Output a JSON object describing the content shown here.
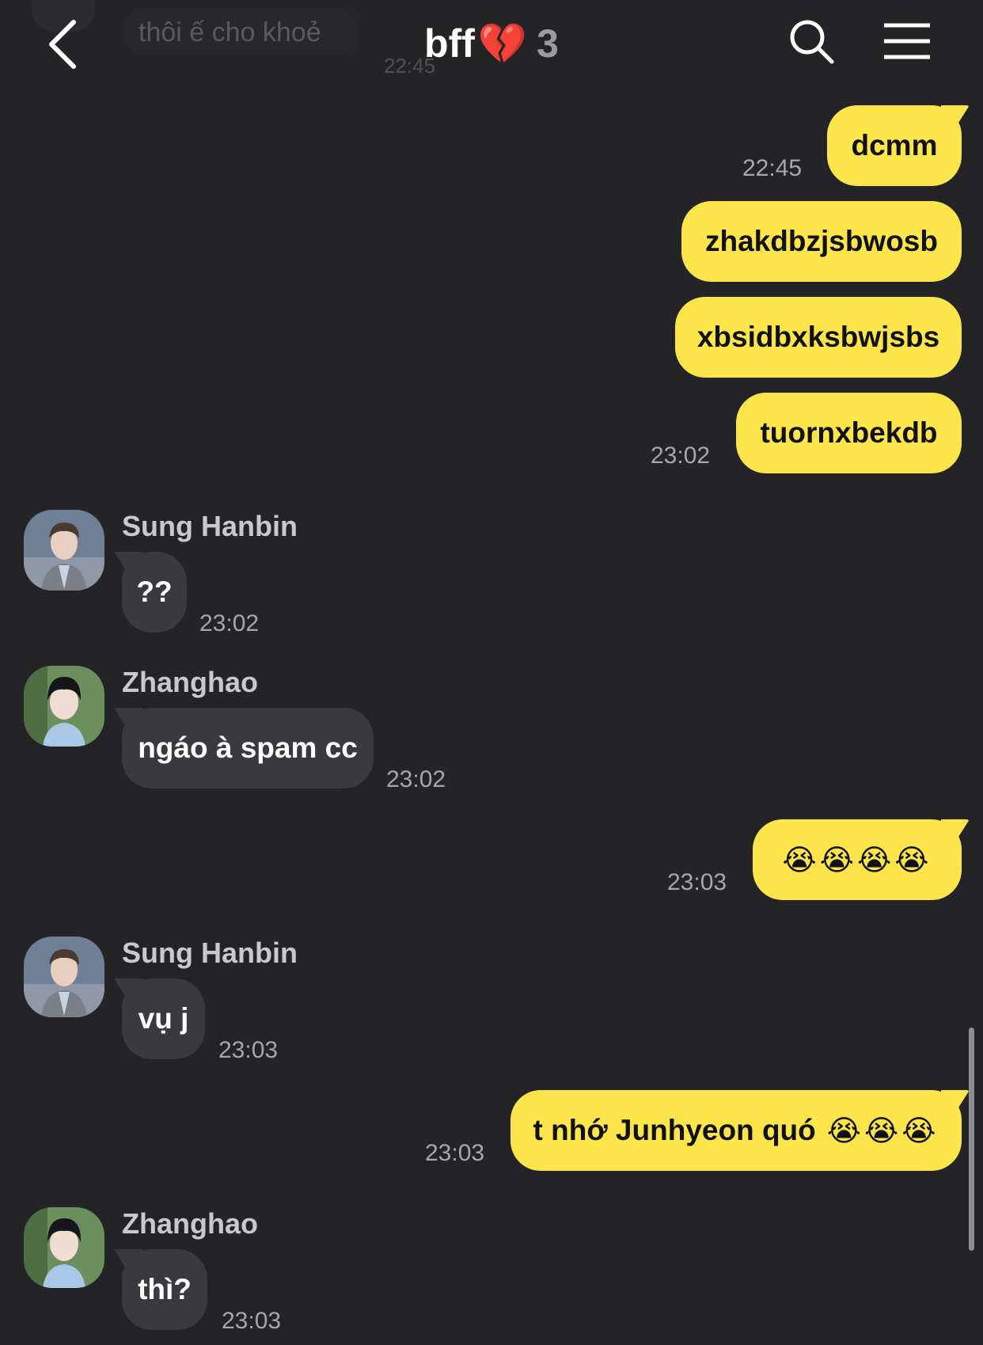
{
  "header": {
    "title": "bff",
    "title_emoji": "💔",
    "member_count": "3",
    "back_icon": "chevron-left-icon",
    "search_icon": "search-icon",
    "menu_icon": "hamburger-menu-icon",
    "prev_message": "thôi ế cho khoẻ",
    "prev_time": "22:45"
  },
  "messages": [
    {
      "from": "me",
      "text": "dcmm",
      "time": "22:45"
    },
    {
      "from": "me",
      "text": "zhakdbzjsbwosb"
    },
    {
      "from": "me",
      "text": "xbsidbxksbwjsbs"
    },
    {
      "from": "me",
      "text": "tuornxbekdb",
      "time": "23:02"
    },
    {
      "from": "Sung Hanbin",
      "text": "??",
      "time": "23:02"
    },
    {
      "from": "Zhanghao",
      "text": "ngáo à spam cc",
      "time": "23:02"
    },
    {
      "from": "me",
      "emoji": "😭😭😭😭",
      "time": "23:03"
    },
    {
      "from": "Sung Hanbin",
      "text": "vụ j",
      "time": "23:03"
    },
    {
      "from": "me",
      "text": "t nhớ Junhyeon quó",
      "emoji": "😭😭😭",
      "time": "23:03"
    },
    {
      "from": "Zhanghao",
      "text": "thì?",
      "time": "23:03"
    }
  ],
  "colors": {
    "background": "#242427",
    "my_bubble": "#fbe54a",
    "their_bubble": "#3a3a3e",
    "timestamp": "#a6a6ab"
  }
}
